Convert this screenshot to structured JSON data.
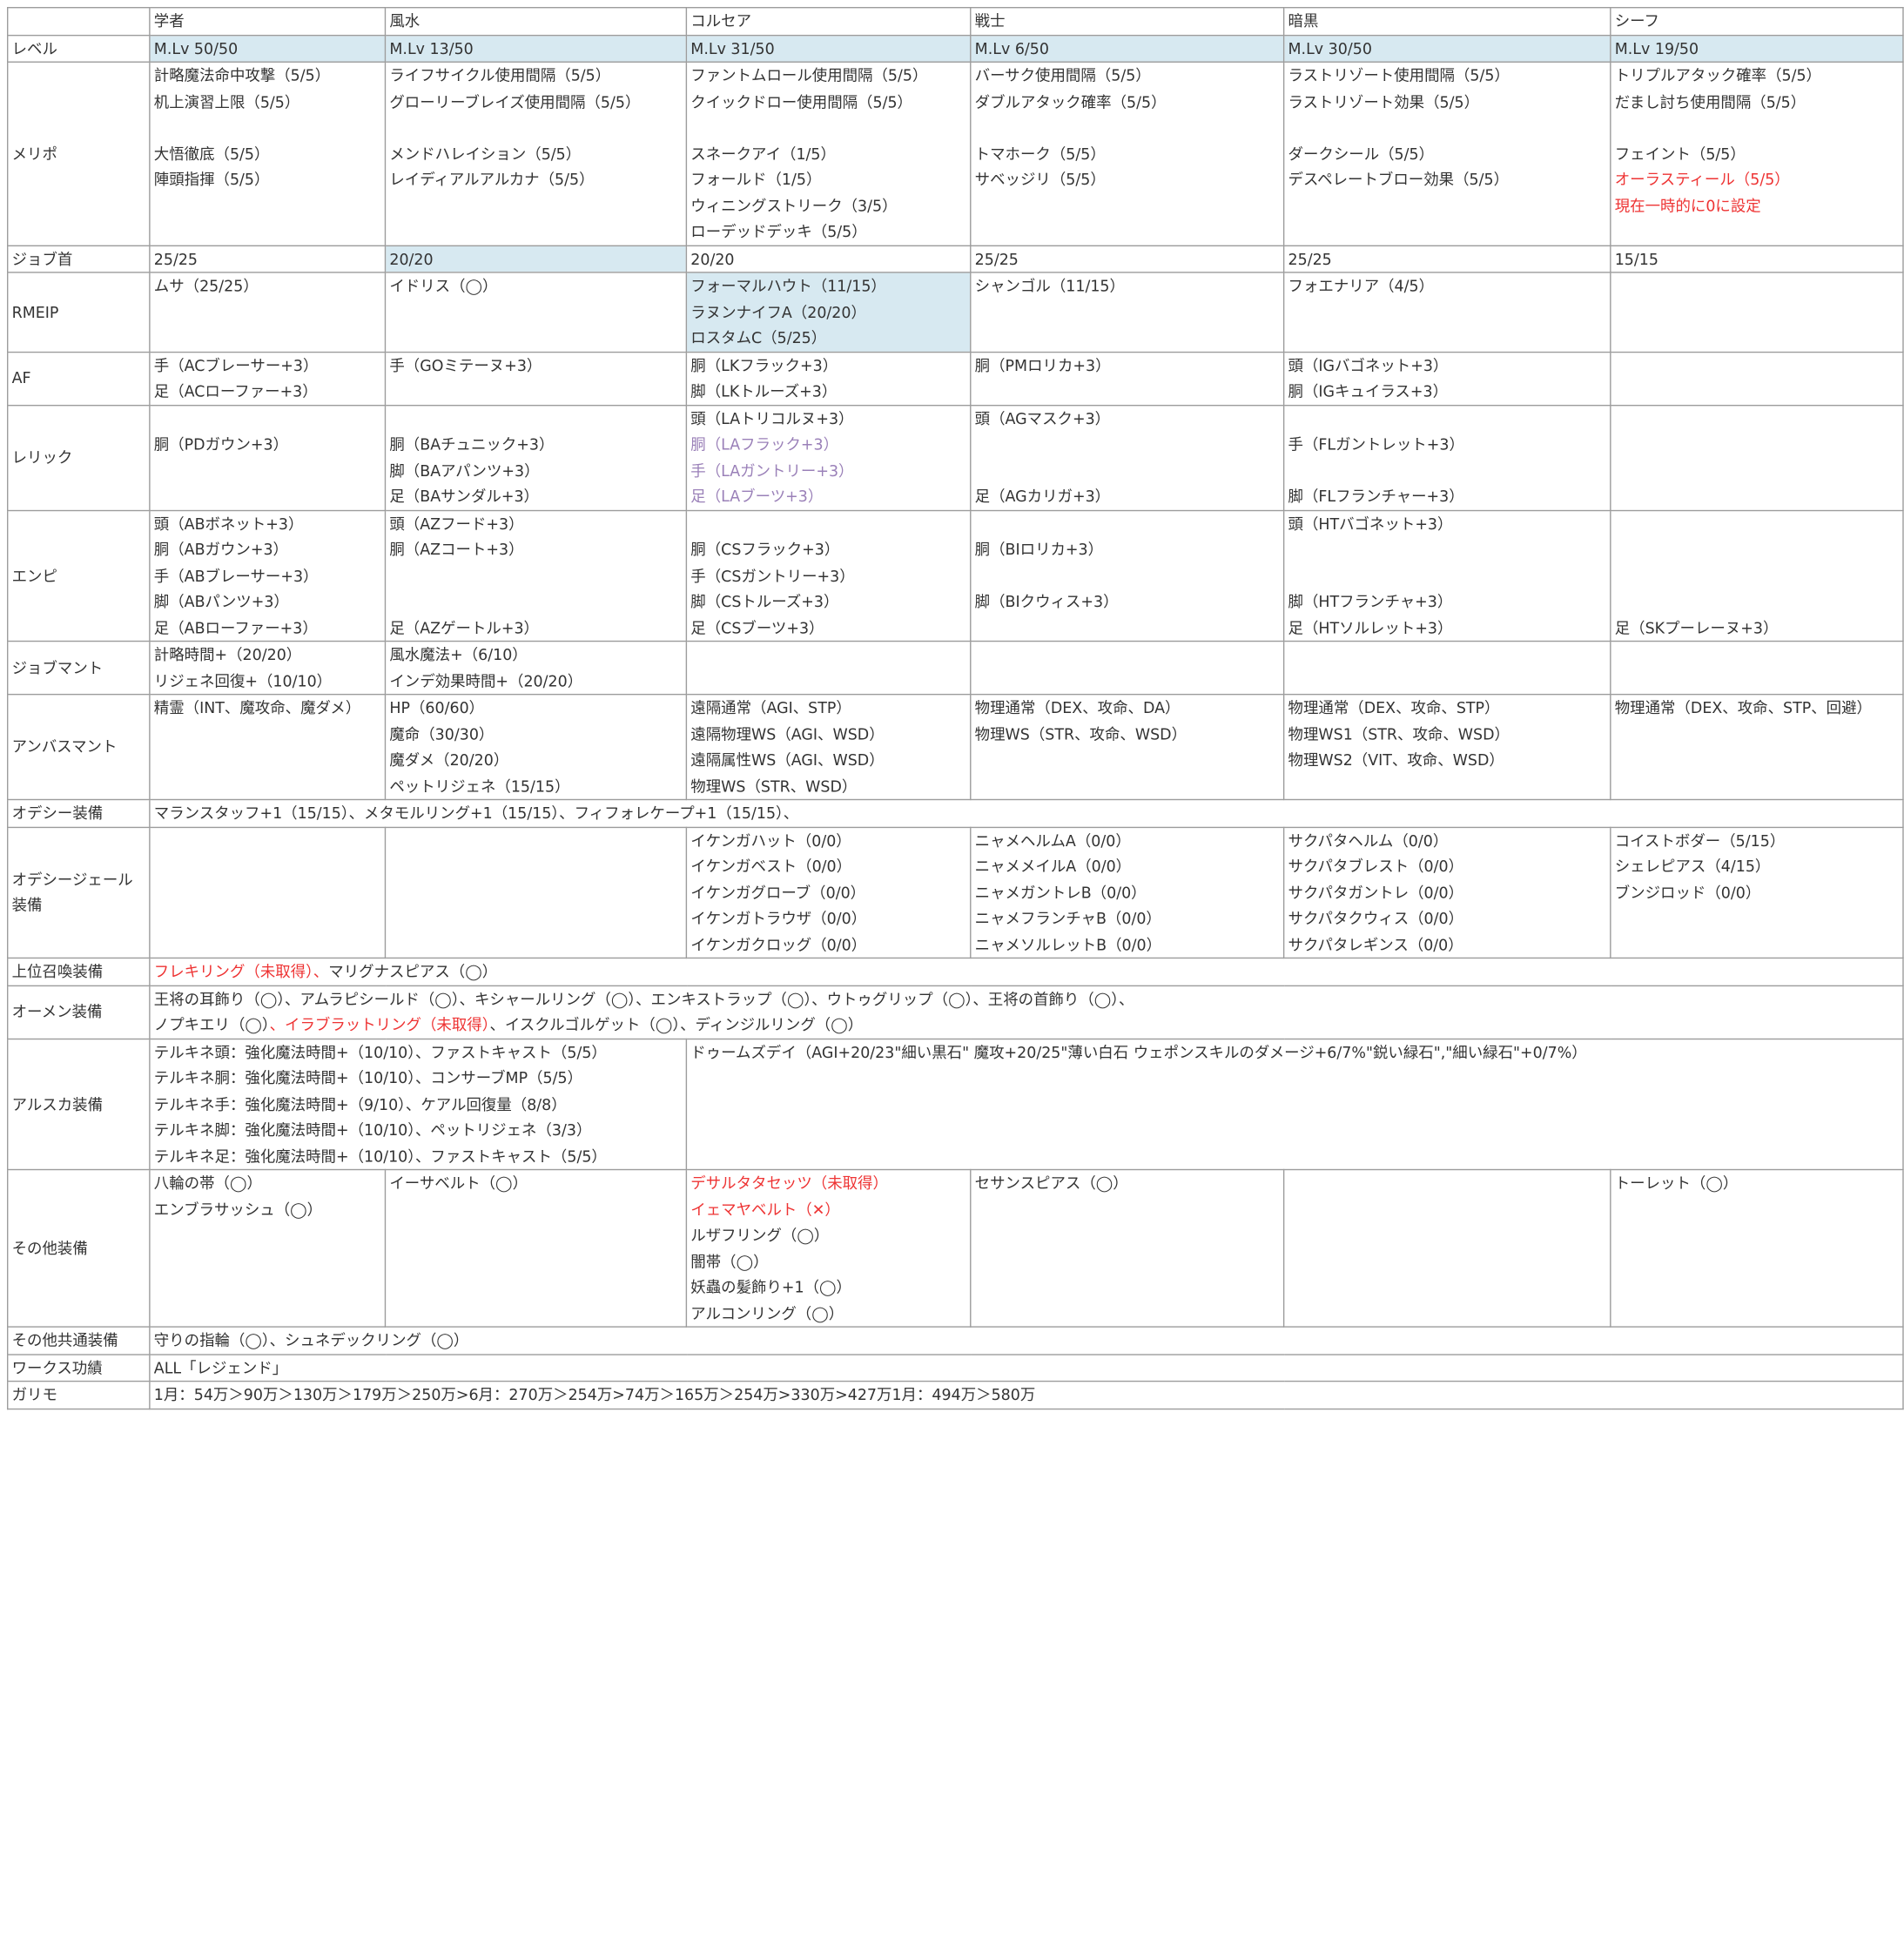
{
  "jobs": [
    "学者",
    "風水",
    "コルセア",
    "戦士",
    "暗黒",
    "シーフ"
  ],
  "rows": {
    "level": {
      "label": "レベル",
      "cells": [
        "M.Lv 50/50",
        "M.Lv 13/50",
        "M.Lv 31/50",
        "M.Lv 6/50",
        "M.Lv 30/50",
        "M.Lv 19/50"
      ]
    },
    "merit": {
      "label": "メリポ",
      "cells": [
        [
          "計略魔法命中攻撃（5/5）",
          "机上演習上限（5/5）",
          "",
          "大悟徹底（5/5）",
          "陣頭指揮（5/5）",
          ""
        ],
        [
          "ライフサイクル使用間隔（5/5）",
          "グローリーブレイズ使用間隔（5/5）",
          "",
          "メンドハレイション（5/5）",
          "レイディアルアルカナ（5/5）",
          ""
        ],
        [
          "ファントムロール使用間隔（5/5）",
          "クイックドロー使用間隔（5/5）",
          "",
          "スネークアイ（1/5）",
          "フォールド（1/5）",
          "ウィニングストリーク（3/5）",
          "ローデッドデッキ（5/5）"
        ],
        [
          "バーサク使用間隔（5/5）",
          "ダブルアタック確率（5/5）",
          "",
          "トマホーク（5/5）",
          "サベッジリ（5/5）"
        ],
        [
          "ラストリゾート使用間隔（5/5）",
          "ラストリゾート効果（5/5）",
          "",
          "ダークシール（5/5）",
          "デスペレートブロー効果（5/5）"
        ],
        [
          "トリプルアタック確率（5/5）",
          "だまし討ち使用間隔（5/5）",
          "",
          "フェイント（5/5）",
          "オーラスティール（5/5）",
          "現在一時的に0に設定"
        ]
      ]
    },
    "job_neck": {
      "label": "ジョブ首",
      "cells": [
        "25/25",
        "20/20",
        "20/20",
        "25/25",
        "25/25",
        "15/15"
      ]
    },
    "rmeip": {
      "label": "RMEIP",
      "cells": [
        [
          "ムサ（25/25）"
        ],
        [
          "イドリス（◯）"
        ],
        [
          "フォーマルハウト（11/15）",
          "ラヌンナイフA（20/20）",
          "ロスタムC（5/25）"
        ],
        [
          "シャンゴル（11/15）"
        ],
        [
          "フォエナリア（4/5）"
        ],
        [
          ""
        ]
      ]
    },
    "af": {
      "label": "AF",
      "cells": [
        [
          "手（ACブレーサー+3）",
          "足（ACローファー+3）"
        ],
        [
          "手（GOミテーヌ+3）"
        ],
        [
          "胴（LKフラック+3）",
          "脚（LKトルーズ+3）"
        ],
        [
          "胴（PMロリカ+3）"
        ],
        [
          "頭（IGバゴネット+3）",
          "胴（IGキュイラス+3）"
        ],
        [
          ""
        ]
      ]
    },
    "relic": {
      "label": "レリック",
      "cells": [
        [
          "",
          "胴（PDガウン+3）",
          "",
          ""
        ],
        [
          "",
          "胴（BAチュニック+3）",
          "脚（BAアパンツ+3）",
          "足（BAサンダル+3）"
        ],
        [
          "頭（LAトリコルヌ+3）",
          "胴（LAフラック+3）",
          "手（LAガントリー+3）",
          "足（LAブーツ+3）"
        ],
        [
          "頭（AGマスク+3）",
          "",
          "",
          "足（AGカリガ+3）"
        ],
        [
          "",
          "手（FLガントレット+3）",
          "",
          "脚（FLフランチャー+3）"
        ],
        [
          ""
        ]
      ]
    },
    "empy": {
      "label": "エンピ",
      "cells": [
        [
          "頭（ABボネット+3）",
          "胴（ABガウン+3）",
          "手（ABブレーサー+3）",
          "脚（ABパンツ+3）",
          "足（ABローファー+3）"
        ],
        [
          "頭（AZフード+3）",
          "胴（AZコート+3）",
          "",
          "",
          "足（AZゲートル+3）"
        ],
        [
          "",
          "胴（CSフラック+3）",
          "手（CSガントリー+3）",
          "脚（CSトルーズ+3）",
          "足（CSブーツ+3）"
        ],
        [
          "",
          "胴（BIロリカ+3）",
          "",
          "脚（BIクウィス+3）",
          ""
        ],
        [
          "頭（HTバゴネット+3）",
          "",
          "",
          "脚（HTフランチャ+3）",
          "足（HTソルレット+3）"
        ],
        [
          "",
          "",
          "",
          "",
          "足（SKプーレーヌ+3）"
        ]
      ]
    },
    "job_cape": {
      "label": "ジョブマント",
      "cells": [
        [
          "計略時間+（20/20）",
          "リジェネ回復+（10/10）"
        ],
        [
          "風水魔法+（6/10）",
          "インデ効果時間+（20/20）"
        ],
        [
          ""
        ],
        [
          ""
        ],
        [
          ""
        ],
        [
          ""
        ]
      ]
    },
    "ambu_cape": {
      "label": "アンバスマント",
      "cells": [
        [
          "精霊（INT、魔攻命、魔ダメ）"
        ],
        [
          "HP（60/60）",
          "魔命（30/30）",
          "魔ダメ（20/20）",
          "ペットリジェネ（15/15）"
        ],
        [
          "遠隔通常（AGI、STP）",
          "遠隔物理WS（AGI、WSD）",
          "遠隔属性WS（AGI、WSD）",
          "物理WS（STR、WSD）"
        ],
        [
          "物理通常（DEX、攻命、DA）",
          "物理WS（STR、攻命、WSD）"
        ],
        [
          "物理通常（DEX、攻命、STP）",
          "物理WS1（STR、攻命、WSD）",
          "物理WS2（VIT、攻命、WSD）"
        ],
        [
          "物理通常（DEX、攻命、STP、回避）"
        ]
      ]
    },
    "odyssey": {
      "label": "オデシー装備",
      "text": "マランスタッフ+1（15/15）、メタモルリング+1（15/15）、フィフォレケープ+1（15/15）、"
    },
    "odyssey_gear": {
      "label_lines": [
        "オデシージェール",
        "装備"
      ],
      "cells": [
        [
          ""
        ],
        [
          ""
        ],
        [
          "イケンガハット（0/0）",
          "イケンガベスト（0/0）",
          "イケンガグローブ（0/0）",
          "イケンガトラウザ（0/0）",
          "イケンガクロッグ（0/0）"
        ],
        [
          "ニャメヘルムA（0/0）",
          "ニャメメイルA（0/0）",
          "ニャメガントレB（0/0）",
          "ニャメフランチャB（0/0）",
          "ニャメソルレットB（0/0）"
        ],
        [
          "サクパタヘルム（0/0）",
          "サクパタブレスト（0/0）",
          "サクパタガントレ（0/0）",
          "サクパタクウィス（0/0）",
          "サクパタレギンス（0/0）"
        ],
        [
          "コイストボダー（5/15）",
          "シェレピアス（4/15）",
          "ブンジロッド（0/0）"
        ]
      ]
    },
    "summon": {
      "label": "上位召喚装備",
      "red_part": "フレキリング（未取得）、",
      "normal_part": "マリグナスピアス（◯）"
    },
    "omen": {
      "label": "オーメン装備",
      "line1": "王将の耳飾り（◯）、アムラピシールド（◯）、キシャールリング（◯）、エンキストラップ（◯）、ウトゥグリップ（◯）、王将の首飾り（◯）、",
      "line2_a": "ノプキエリ（◯）",
      "line2_b": "、イラブラットリング（未取得）",
      "line2_c": "、イスクルゴルゲット（◯）",
      "line2_d": "、ディンジルリング（◯）"
    },
    "aruska": {
      "label": "アルスカ装備",
      "left": [
        "テルキネ頭：強化魔法時間+（10/10）、ファストキャスト（5/5）",
        "テルキネ胴：強化魔法時間+（10/10）、コンサーブMP（5/5）",
        "テルキネ手：強化魔法時間+（9/10）、ケアル回復量（8/8）",
        "テルキネ脚：強化魔法時間+（10/10）、ペットリジェネ（3/3）",
        "テルキネ足：強化魔法時間+（10/10）、ファストキャスト（5/5）"
      ],
      "right": "ドゥームズデイ（AGI+20/23\"細い黒石\" 魔攻+20/25\"薄い白石 ウェポンスキルのダメージ+6/7%\"鋭い緑石\",\"細い緑石\"+0/7%）"
    },
    "other": {
      "label": "その他装備",
      "cells": [
        [
          "八輪の帯（◯）",
          "エンブラサッシュ（◯）"
        ],
        [
          "イーサベルト（◯）"
        ],
        [
          "デサルタタセッツ（未取得）",
          "イェマヤベルト（✕）",
          "ルザフリング（◯）",
          "闇帯（◯）",
          "妖蟲の髪飾り+1（◯）",
          "アルコンリング（◯）"
        ],
        [
          "セサンスピアス（◯）"
        ],
        [
          ""
        ],
        [
          "トーレット（◯）"
        ]
      ]
    },
    "common": {
      "label": "その他共通装備",
      "text": "守りの指輪（◯）、シュネデックリング（◯）"
    },
    "works": {
      "label": "ワークス功績",
      "text": "ALL「レジェンド」"
    },
    "gallimo": {
      "label": "ガリモ",
      "text": "1月：54万＞90万＞130万＞179万＞250万>6月：270万＞254万>74万＞165万＞254万>330万>427万1月：494万＞580万"
    }
  },
  "colors": {
    "highlight": "#d7e9f1",
    "red_text": "#ee3333",
    "muted_text": "#9a80b8",
    "grid_line": "#9c9c9c"
  }
}
